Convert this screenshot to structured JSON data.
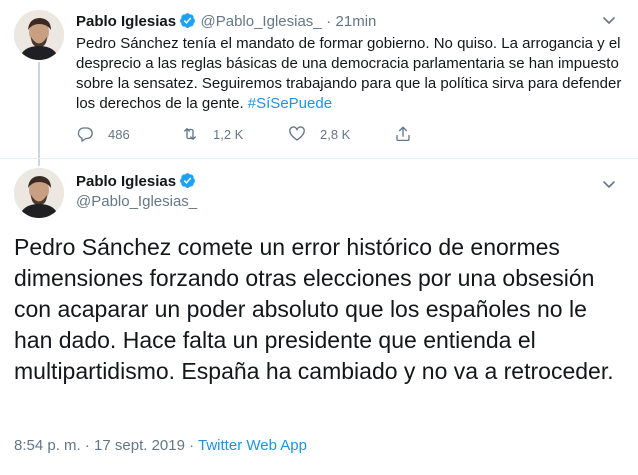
{
  "tweet1": {
    "author_name": "Pablo Iglesias",
    "author_handle": "@Pablo_Iglesias_",
    "separator": "·",
    "time": "21min",
    "text": "Pedro Sánchez tenía el mandato de formar gobierno. No quiso. La arrogancia y el desprecio a las reglas básicas de una democracia parlamentaria se han impuesto sobre la sensatez. Seguiremos trabajando para que la política sirva para defender los derechos de la gente.",
    "hashtag": "#SíSePuede",
    "replies": "486",
    "retweets": "1,2 K",
    "likes": "2,8 K"
  },
  "tweet2": {
    "author_name": "Pablo Iglesias",
    "author_handle": "@Pablo_Iglesias_",
    "text": "Pedro Sánchez comete un error histórico de enormes dimensiones forzando otras elecciones por una obsesión con acaparar un poder absoluto que los españoles no le han dado. Hace falta un presidente que entienda el multipartidismo. España ha cambiado y no va a retroceder.",
    "timestamp": "8:54 p. m. · 17 sept. 2019 ·",
    "source": "Twitter Web App"
  },
  "colors": {
    "text": "#14171a",
    "muted": "#657786",
    "link": "#1b95e0",
    "verified": "#1da1f2",
    "divider": "#e6ecf0"
  },
  "icons": [
    "verified-badge-icon",
    "chevron-down-icon",
    "reply-icon",
    "retweet-icon",
    "like-icon",
    "share-icon"
  ]
}
